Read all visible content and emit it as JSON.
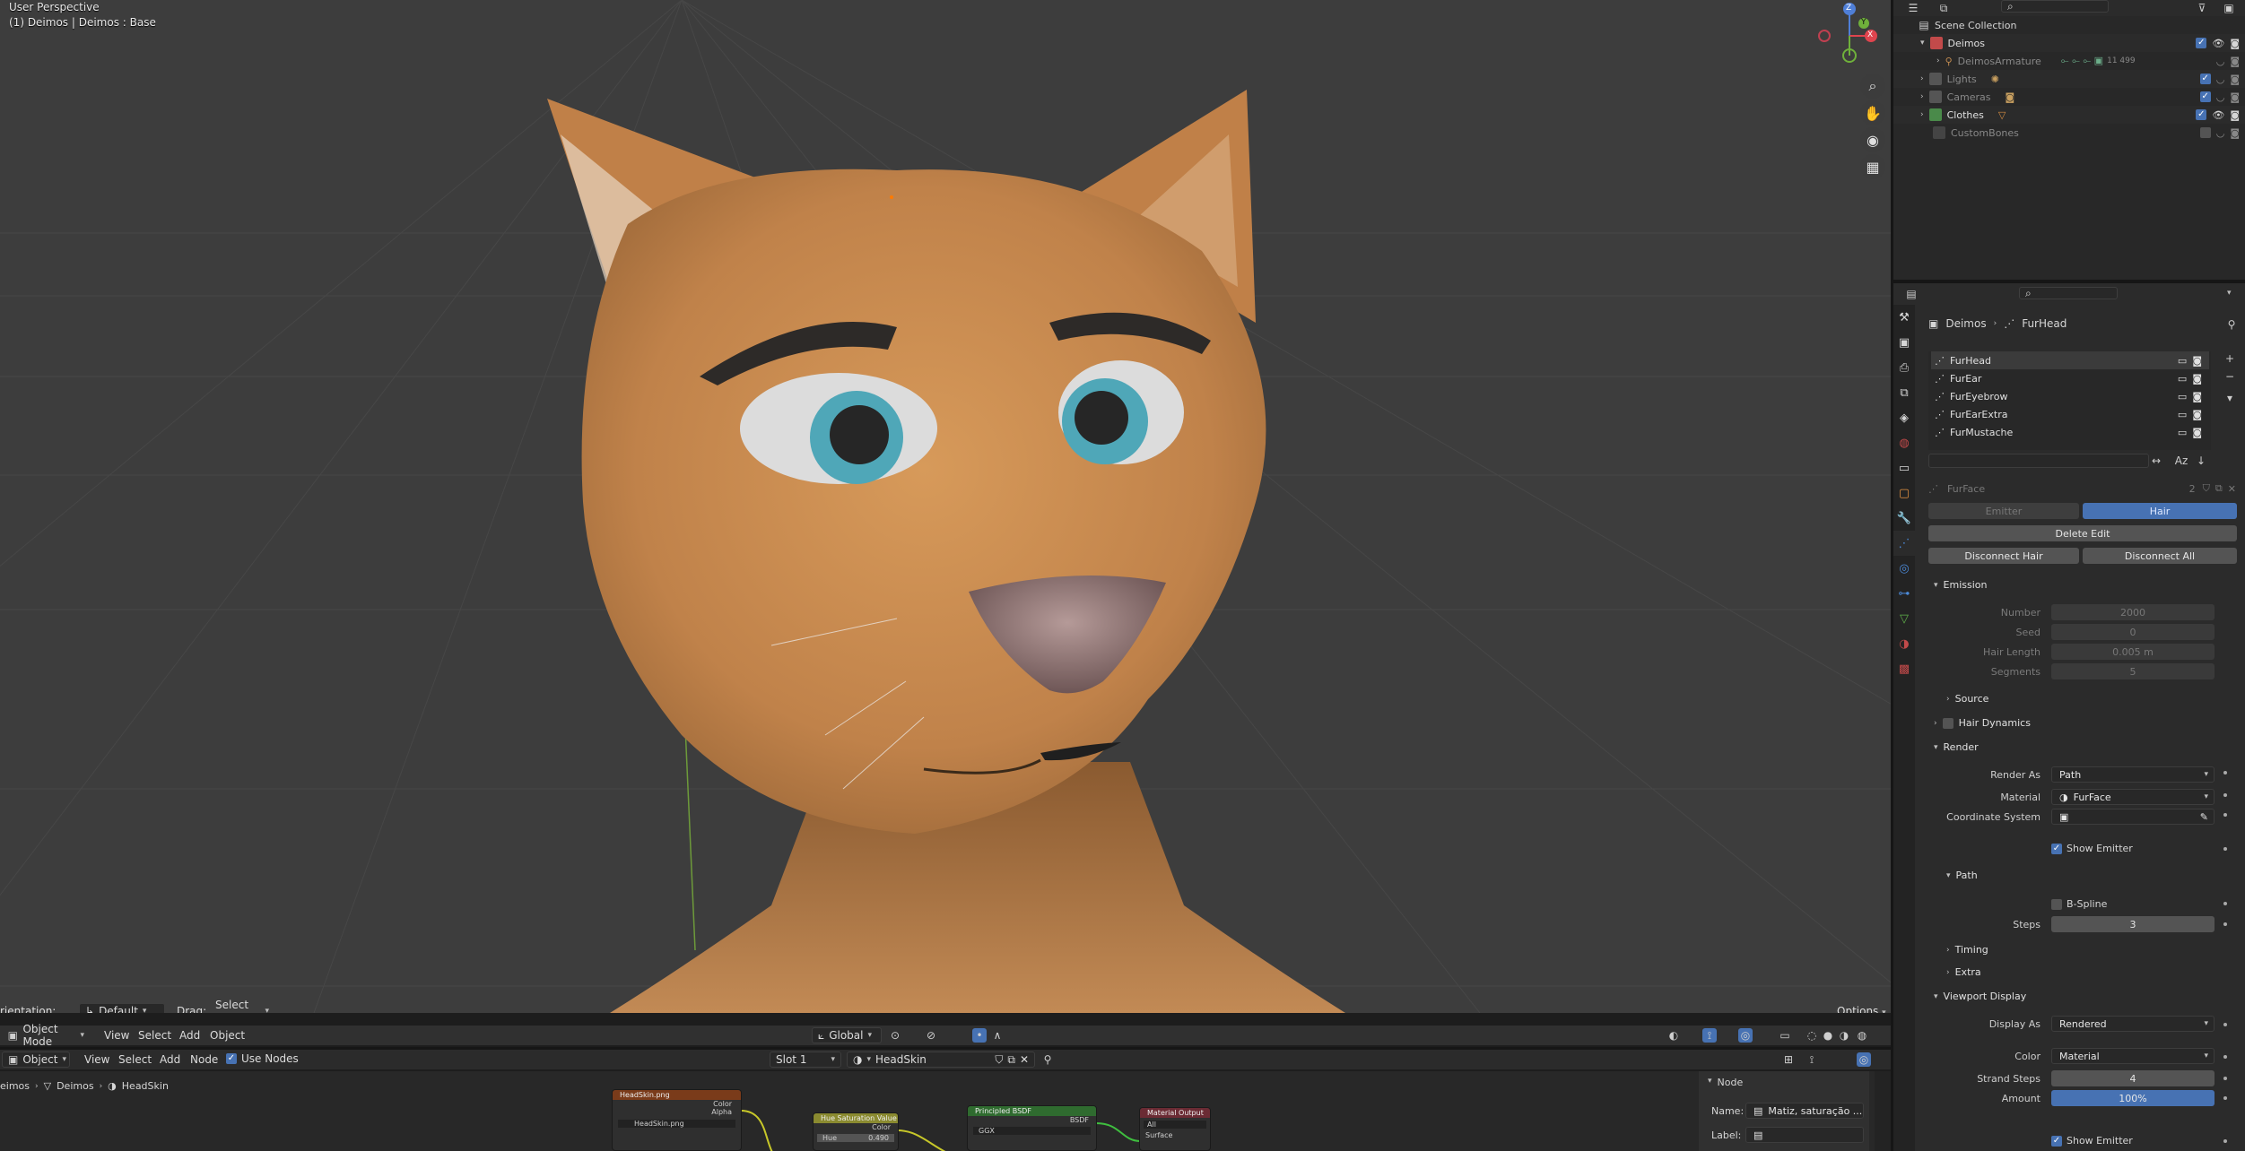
{
  "viewport": {
    "title": "User Perspective",
    "subtitle": "(1) Deimos | Deimos : Base",
    "gizmo": {
      "x": "X",
      "y": "Y",
      "z": "Z"
    }
  },
  "tool_header": {
    "orientation_label": "rientation:",
    "orientation_value": "Default",
    "drag_label": "Drag:",
    "drag_value": "Select Box",
    "options": "Options"
  },
  "viewport_header": {
    "mode": "Object Mode",
    "menus": [
      "View",
      "Select",
      "Add",
      "Object"
    ],
    "transform": "Global"
  },
  "node_header": {
    "type": "Object",
    "menus": [
      "View",
      "Select",
      "Add",
      "Node"
    ],
    "use_nodes": "Use Nodes",
    "slot": "Slot 1",
    "material": "HeadSkin"
  },
  "node_breadcrumb": [
    "eimos",
    "Deimos",
    "HeadSkin"
  ],
  "nodes": [
    {
      "title": "HeadSkin.png",
      "color": "#7a3b1a",
      "rows": [
        "Color",
        "Alpha",
        "HeadSkin.png"
      ]
    },
    {
      "title": "Hue Saturation Value",
      "color": "#8a8a30",
      "rows": [
        "Color",
        "Hue",
        "0.490"
      ]
    },
    {
      "title": "Principled BSDF",
      "color": "#2f6b2f",
      "rows": [
        "BSDF",
        "GGX"
      ]
    },
    {
      "title": "Material Output",
      "color": "#6b2b34",
      "rows": [
        "All",
        "Surface"
      ]
    }
  ],
  "node_panel": {
    "title": "Node",
    "name_label": "Name:",
    "name_value": "Matiz, saturação ...",
    "label_label": "Label:"
  },
  "outliner": {
    "root": "Scene Collection",
    "items": [
      {
        "name": "Deimos",
        "color": "#e06c6c"
      },
      {
        "name": "DeimosArmature",
        "color": "#7d7d7d",
        "badge": "11 499"
      },
      {
        "name": "Lights",
        "color": "#7d7d7d"
      },
      {
        "name": "Cameras",
        "color": "#7d7d7d"
      },
      {
        "name": "Clothes",
        "color": "#d6d6d6"
      },
      {
        "name": "CustomBones",
        "color": "#7d7d7d"
      }
    ]
  },
  "properties": {
    "breadcrumb": [
      "Deimos",
      "FurHead"
    ],
    "systems": [
      "FurHead",
      "FurEar",
      "FurEyebrow",
      "FurEarExtra",
      "FurMustache"
    ],
    "settings_name": "FurFace",
    "settings_users": "2",
    "type_tabs": [
      "Emitter",
      "Hair"
    ],
    "delete_edit": "Delete Edit",
    "disconnect_hair": "Disconnect Hair",
    "disconnect_all": "Disconnect All",
    "emission": {
      "title": "Emission",
      "number_label": "Number",
      "number": "2000",
      "seed_label": "Seed",
      "seed": "0",
      "length_label": "Hair Length",
      "length": "0.005 m",
      "segments_label": "Segments",
      "segments": "5"
    },
    "source": "Source",
    "hair_dynamics": "Hair Dynamics",
    "render": {
      "title": "Render",
      "render_as_label": "Render As",
      "render_as": "Path",
      "material_label": "Material",
      "material": "FurFace",
      "coord_label": "Coordinate System",
      "show_emitter": "Show Emitter"
    },
    "path": {
      "title": "Path",
      "bspline": "B-Spline",
      "steps_label": "Steps",
      "steps": "3"
    },
    "timing": "Timing",
    "extra": "Extra",
    "viewport_display": {
      "title": "Viewport Display",
      "display_as_label": "Display As",
      "display_as": "Rendered",
      "color_label": "Color",
      "color": "Material",
      "strand_label": "Strand Steps",
      "strand": "4",
      "amount_label": "Amount",
      "amount": "100%",
      "show_emitter": "Show Emitter"
    }
  },
  "colors": {
    "accent": "#4772b3",
    "fur": "#c98a4e",
    "eye": "#4fa7b8"
  }
}
